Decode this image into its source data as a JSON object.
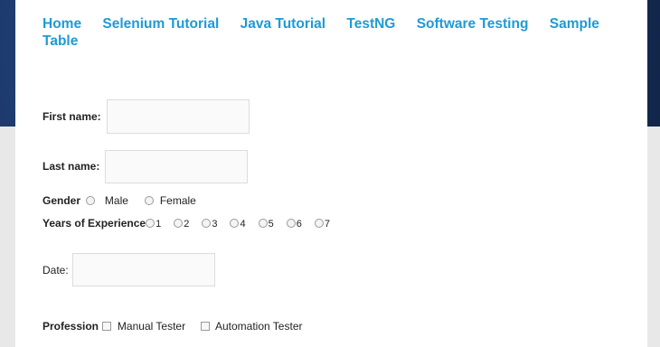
{
  "nav": {
    "items": [
      {
        "label": "Home"
      },
      {
        "label": "Selenium Tutorial"
      },
      {
        "label": "Java Tutorial"
      },
      {
        "label": "TestNG"
      },
      {
        "label": "Software Testing"
      },
      {
        "label": "Sample Table"
      }
    ]
  },
  "form": {
    "first_name": {
      "label": "First name:",
      "value": ""
    },
    "last_name": {
      "label": "Last name:",
      "value": ""
    },
    "gender": {
      "label": "Gender",
      "options": [
        "Male",
        "Female"
      ]
    },
    "experience": {
      "label": "Years of Experience",
      "options": [
        "1",
        "2",
        "3",
        "4",
        "5",
        "6",
        "7"
      ]
    },
    "date": {
      "label": "Date:",
      "value": ""
    },
    "profession": {
      "label": "Profession",
      "options": [
        "Manual Tester",
        "Automation Tester"
      ]
    }
  },
  "colors": {
    "link": "#1e9ad6",
    "background_top": "#1a3566",
    "page": "#ffffff"
  }
}
